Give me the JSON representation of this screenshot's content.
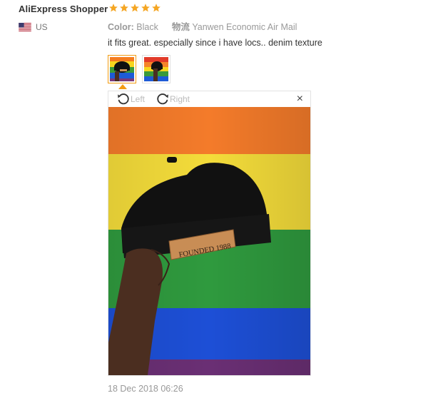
{
  "review": {
    "reviewer_name": "AliExpress Shopper",
    "rating": 5,
    "country": "US",
    "color_label": "Color:",
    "color_value": "Black",
    "shipping_label": "物流",
    "shipping_value": "Yanwen Economic Air Mail",
    "text": "it fits great. especially since i have locs.. denim texture",
    "date": "18 Dec 2018 06:26"
  },
  "viewer": {
    "rotate_left_label": "Left",
    "rotate_right_label": "Right",
    "close_glyph": "×",
    "photo_label_text": "FOUNDED 1988"
  },
  "colors": {
    "star": "#f5a623",
    "thumb_active_border": "#f39c12",
    "flag_red": "#b22234",
    "flag_blue": "#3c3b6e"
  },
  "icons": {
    "stars": "star-icon",
    "flag": "us-flag-icon",
    "rotate_left": "rotate-left-icon",
    "rotate_right": "rotate-right-icon",
    "close": "close-icon"
  }
}
